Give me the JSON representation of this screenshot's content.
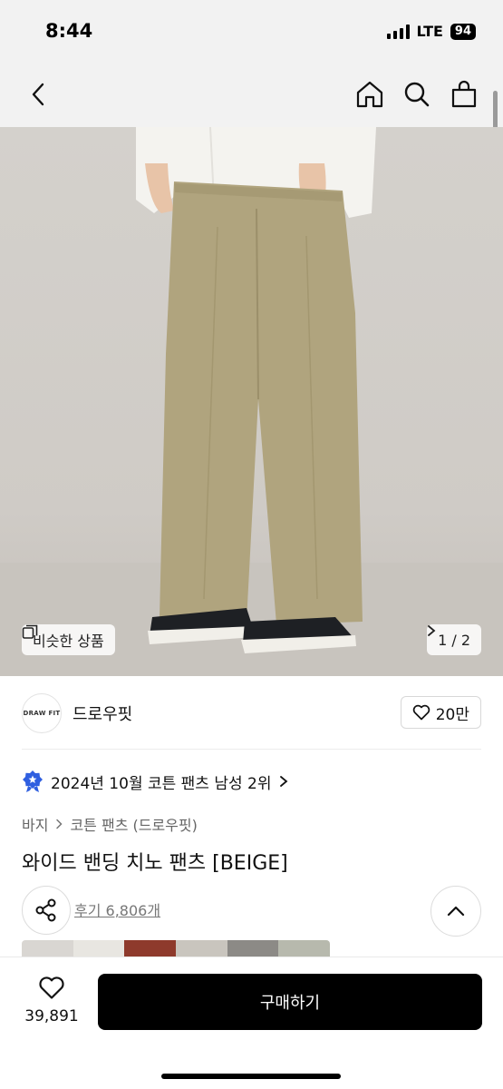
{
  "status_bar": {
    "time": "8:44",
    "network": "LTE",
    "battery": "94"
  },
  "nav": {
    "back_icon": "chevron-left-icon",
    "home_icon": "home-icon",
    "search_icon": "search-icon",
    "cart_icon": "shopping-bag-icon"
  },
  "hero": {
    "similar_label": "비슷한 상품",
    "page_indicator": "1 / 2",
    "colors": {
      "background": "#d1cdc8",
      "pants": "#b0a47e",
      "shirt": "#f4f3ef"
    }
  },
  "brand": {
    "logo_text": "DRAW FIT",
    "name": "드로우핏",
    "like_count": "20만"
  },
  "product": {
    "ranking_text": "2024년 10월 코튼 팬츠 남성 2위",
    "breadcrumb": [
      "바지",
      "코튼 팬츠 (드로우핏)"
    ],
    "title": "와이드 밴딩 치노 팬츠 [BEIGE]",
    "review_text": "후기 6,806개"
  },
  "thumbnails": [
    "#d9d6d2",
    "#e8e6e1",
    "#8e3a2c",
    "#c9c5be",
    "#8c8a86",
    "#b7b9ad"
  ],
  "bottom_bar": {
    "like_count": "39,891",
    "buy_label": "구매하기",
    "accent": "#000000"
  }
}
